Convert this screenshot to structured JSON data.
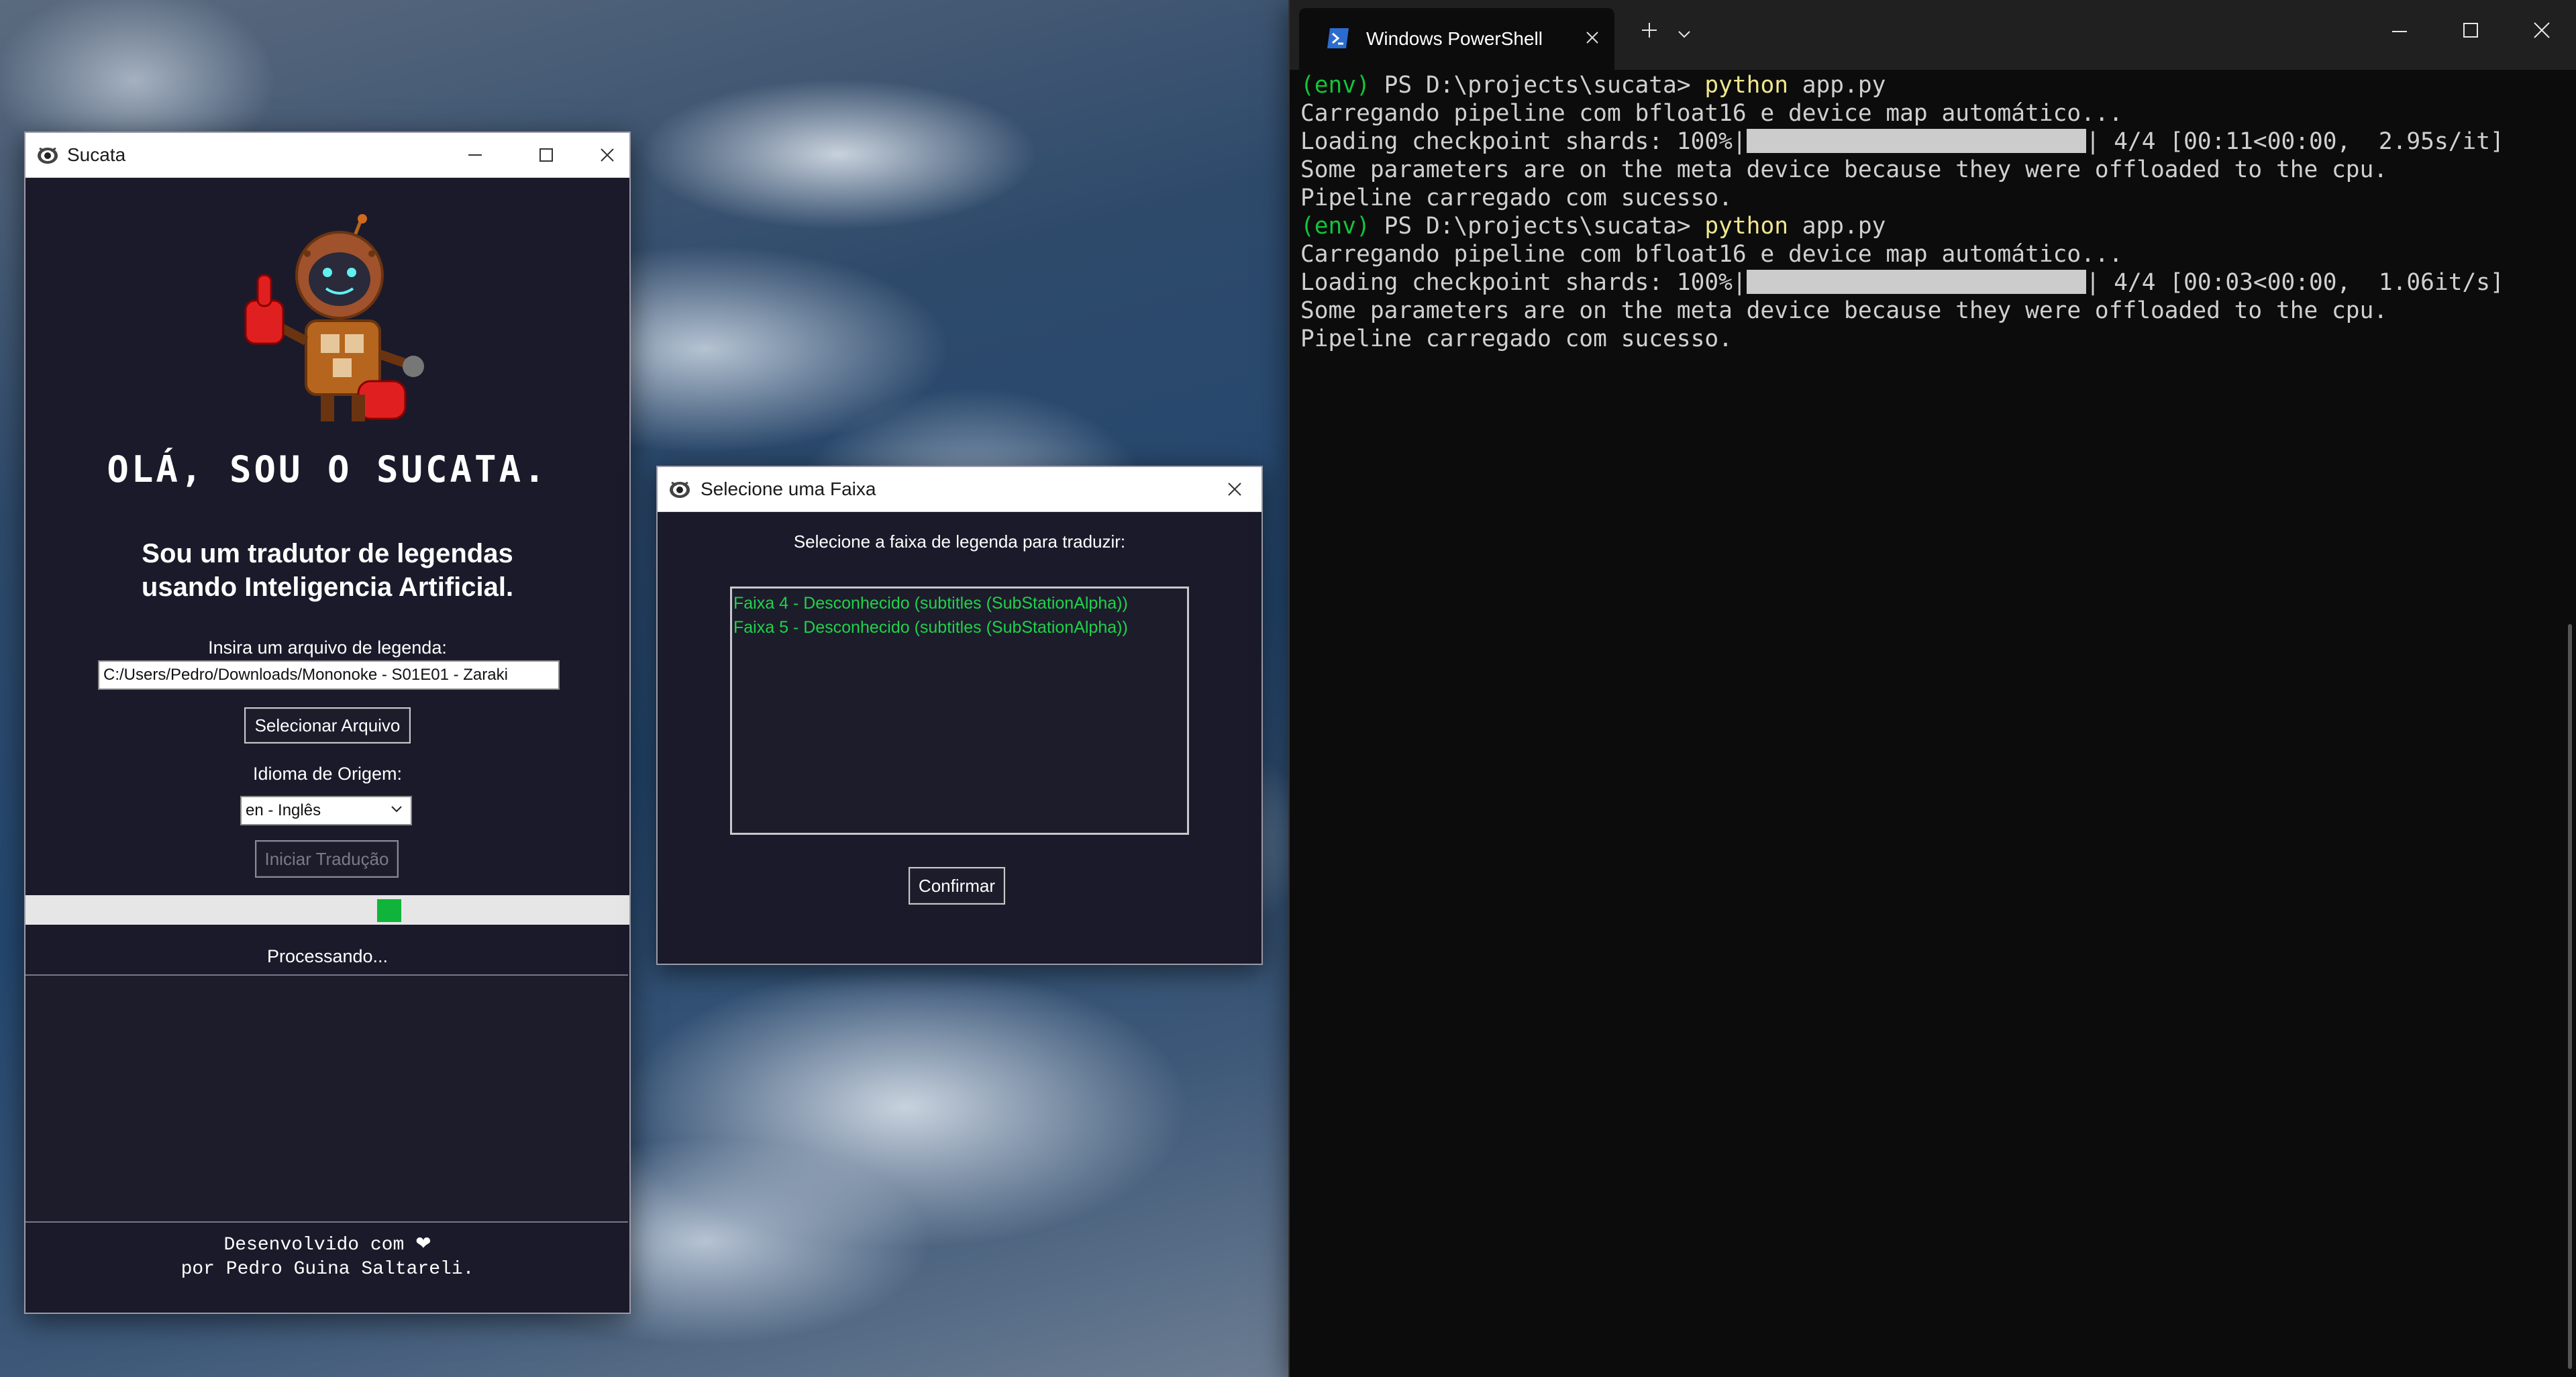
{
  "sucata_window": {
    "title": "Sucata",
    "heading": "OLÁ, SOU O SUCATA.",
    "subtitle_line1": "Sou um tradutor de legendas",
    "subtitle_line2": "usando Inteligencia Artificial.",
    "file_label": "Insira um arquivo de legenda:",
    "file_value": "C:/Users/Pedro/Downloads/Mononoke - S01E01 - Zaraki",
    "select_file_button": "Selecionar Arquivo",
    "language_label": "Idioma de Origem:",
    "language_value": "en - Inglês",
    "start_button": "Iniciar Tradução",
    "status": "Processando...",
    "footer_line1": "Desenvolvido com ❤",
    "footer_line2": "por Pedro Guina Saltareli."
  },
  "track_dialog": {
    "title": "Selecione uma Faixa",
    "prompt": "Selecione a faixa de legenda para traduzir:",
    "tracks": [
      "Faixa 4 - Desconhecido (subtitles (SubStationAlpha))",
      "Faixa 5 - Desconhecido (subtitles (SubStationAlpha))"
    ],
    "confirm_button": "Confirmar"
  },
  "powershell": {
    "tab_title": "Windows PowerShell",
    "lines": {
      "l1_env": "(env)",
      "l1_prompt": " PS D:\\projects\\sucata> ",
      "l1_cmd": "python",
      "l1_arg": " app.py",
      "l2": "Carregando pipeline com bfloat16 e device map automático...",
      "l3_pre": "Loading checkpoint shards: 100%|",
      "l3_post": "| 4/4 [00:11<00:00,  2.95s/it]",
      "l4": "Some parameters are on the meta device because they were offloaded to the cpu.",
      "l5": "Pipeline carregado com sucesso.",
      "l6_env": "(env)",
      "l6_prompt": " PS D:\\projects\\sucata> ",
      "l6_cmd": "python",
      "l6_arg": " app.py",
      "l7": "Carregando pipeline com bfloat16 e device map automático...",
      "l8_pre": "Loading checkpoint shards: 100%|",
      "l8_post": "| 4/4 [00:03<00:00,  1.06it/s]",
      "l9": "Some parameters are on the meta device because they were offloaded to the cpu.",
      "l10": "Pipeline carregado com sucesso."
    }
  },
  "icons": {
    "app_icon": "eye-icon",
    "powershell_icon": "powershell-icon",
    "robot_logo": "robot-thumbs-up-logo"
  },
  "colors": {
    "app_background": "#1b1a2a",
    "progress_green": "#10b43a",
    "track_text_green": "#1fd24a",
    "terminal_background": "#0c0c0c"
  }
}
